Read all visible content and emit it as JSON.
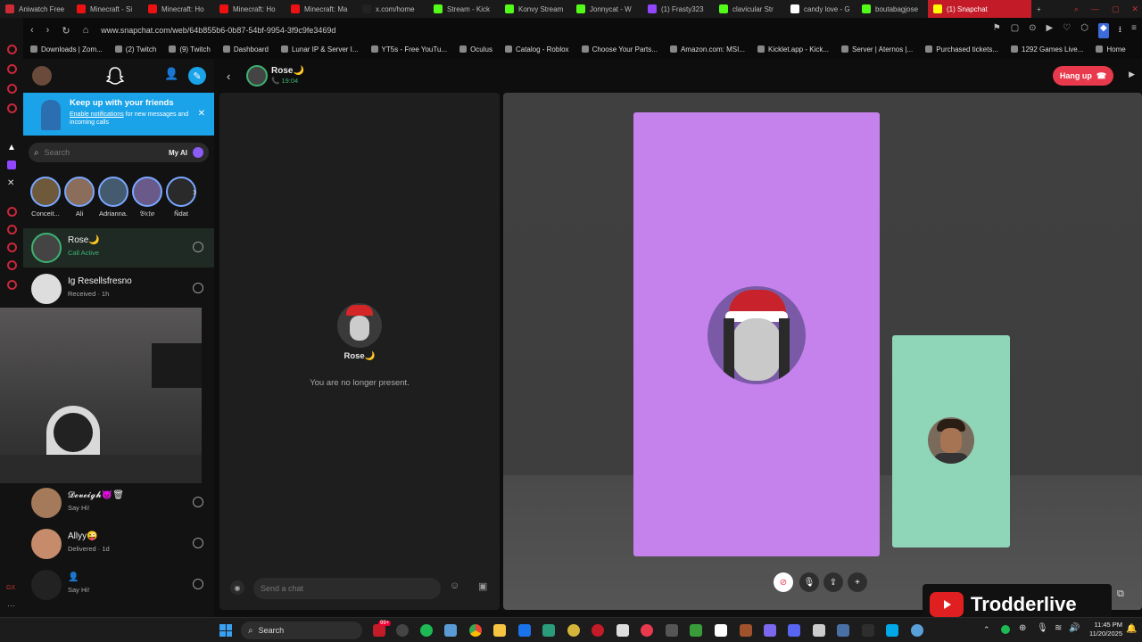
{
  "tabs": [
    {
      "label": "Aniwatch Free",
      "color": "#cc2b36"
    },
    {
      "label": "Minecraft - Si",
      "color": "#e11"
    },
    {
      "label": "Minecraft: Ho",
      "color": "#e11"
    },
    {
      "label": "Minecraft: Ho",
      "color": "#e11"
    },
    {
      "label": "Minecraft: Ma",
      "color": "#e11"
    },
    {
      "label": "x.com/home",
      "color": "#222"
    },
    {
      "label": "Stream - Kick",
      "color": "#53fc18"
    },
    {
      "label": "Konvy Stream",
      "color": "#53fc18"
    },
    {
      "label": "Jonnycat - W",
      "color": "#53fc18"
    },
    {
      "label": "(1) Frasty323",
      "color": "#9146ff"
    },
    {
      "label": "clavicular Str",
      "color": "#53fc18"
    },
    {
      "label": "candy love - G",
      "color": "#fff"
    },
    {
      "label": "boutabagjose",
      "color": "#53fc18"
    },
    {
      "label": "(1) Snapchat",
      "color": "#fffc00"
    }
  ],
  "address": {
    "url": "www.snapchat.com/web/64b855b6-0b87-54bf-9954-3f9c9fe3469d"
  },
  "bookmarks": [
    "Downloads | Zom...",
    "(2) Twitch",
    "(9) Twitch",
    "Dashboard",
    "Lunar IP & Server I...",
    "YT5s - Free YouTu...",
    "Oculus",
    "Catalog - Roblox",
    "Choose Your Parts...",
    "Amazon.com: MSI...",
    "Kicklet.app - Kick...",
    "Server | Aternos |...",
    "Purchased tickets...",
    "1292 Games Live...",
    "Home"
  ],
  "banner": {
    "title": "Keep up with your friends",
    "link": "Enable notifications",
    "rest": " for new messages and incoming calls"
  },
  "search": {
    "placeholder": "Search",
    "my_ai": "My AI"
  },
  "stories": [
    "Conceit...",
    "Ali",
    "Adrianna.",
    "𝔅𝔦𝔠𝔥𝔬",
    "Ñdat"
  ],
  "chats": [
    {
      "name": "Rose🌙",
      "status": "Call Active"
    },
    {
      "name": "Ig Resellsfresno",
      "status": "Received · 1h"
    },
    {
      "name": "𝓓𝓮𝓿𝓮𝓲𝓰𝓱😈🗑",
      "status": "Say Hi!"
    },
    {
      "name": "Allyy😜",
      "status": "Delivered · 1d"
    },
    {
      "name": "👤",
      "status": "Say Hi!"
    }
  ],
  "header": {
    "name": "Rose🌙",
    "time": "19:04",
    "hangup": "Hang up"
  },
  "chat": {
    "name": "Rose🌙",
    "notice": "You are no longer present.",
    "placeholder": "Send a chat"
  },
  "overlay": {
    "brand": "Trodderlive"
  },
  "taskbar": {
    "search": "Search",
    "time": "11:45 PM",
    "date": "11/20/2025",
    "badge": "99+"
  }
}
